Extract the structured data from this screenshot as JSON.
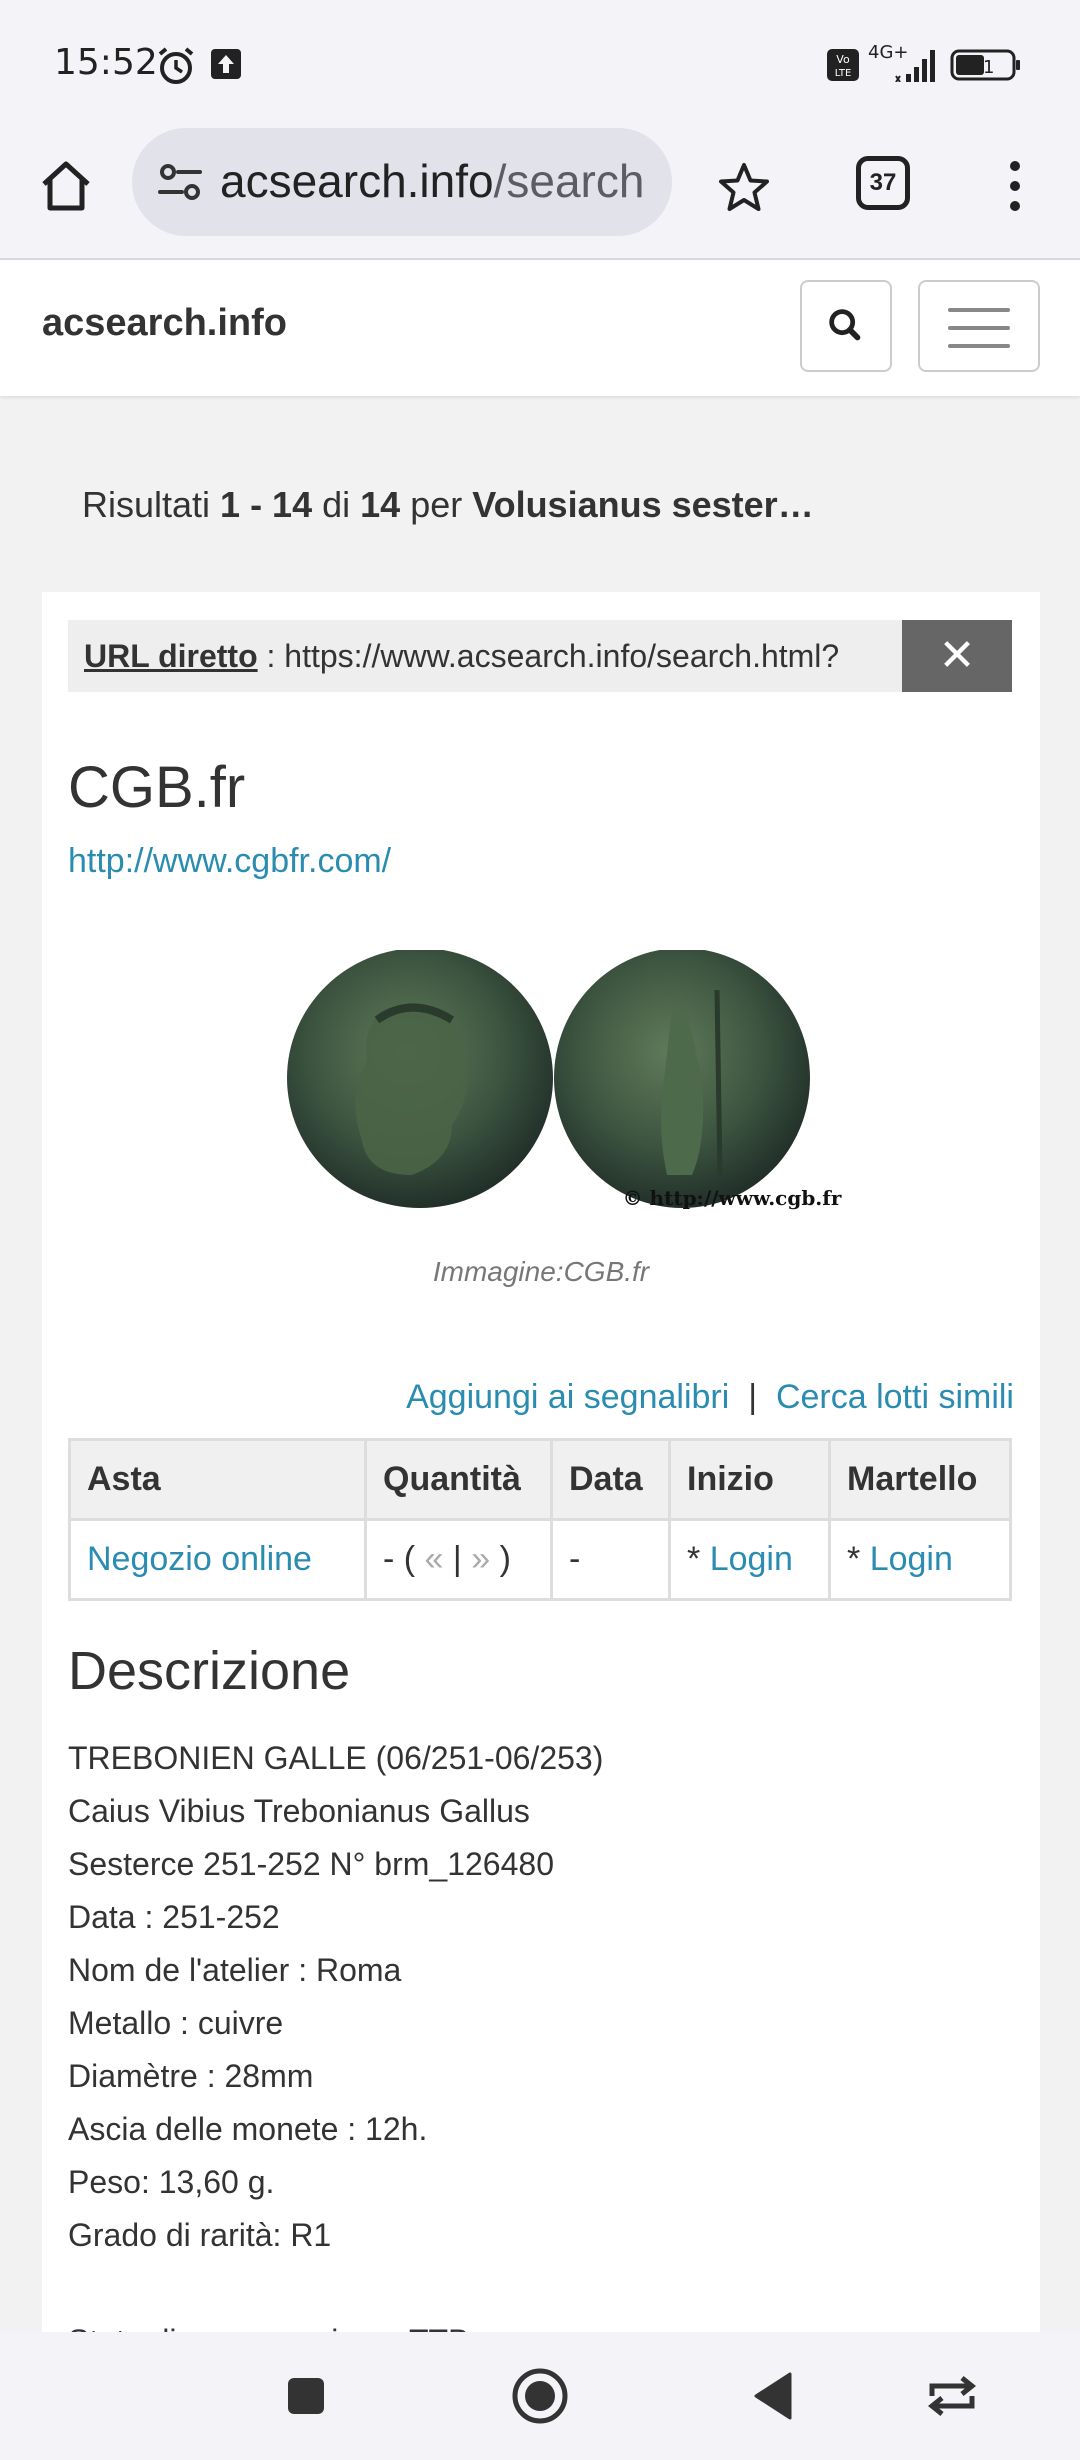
{
  "status_bar": {
    "time": "15:52",
    "network": "4G+",
    "battery": "51",
    "icons": [
      "alarm-icon",
      "upload-icon",
      "volte-icon",
      "signal-icon",
      "battery-icon"
    ]
  },
  "browser": {
    "url_host": "acsearch.info",
    "url_path": "/search",
    "tab_count": "37",
    "icons": [
      "home-icon",
      "site-info-icon",
      "star-icon",
      "tabs-icon",
      "menu-dots-icon"
    ]
  },
  "site": {
    "brand": "acsearch.info"
  },
  "results": {
    "prefix": "Risultati ",
    "range": "1 - 14",
    "of": " di ",
    "total": "14",
    "per": " per ",
    "query": "Volusianus sester…"
  },
  "direct_url": {
    "label": "URL diretto",
    "separator": " : ",
    "value": "https://www.acsearch.info/search.html?",
    "close": "✕"
  },
  "seller": {
    "name": "CGB.fr",
    "link": "http://www.cgbfr.com/"
  },
  "image": {
    "watermark": "© http://www.cgb.fr",
    "caption": "Immagine:CGB.fr"
  },
  "actions": {
    "bookmark": "Aggiungi ai segnalibri",
    "separator": "|",
    "similar": "Cerca lotti simili"
  },
  "table": {
    "headers": [
      "Asta",
      "Quantità",
      "Data",
      "Inizio",
      "Martello"
    ],
    "row": {
      "asta": "Negozio online",
      "quantita_prefix": "- (",
      "quantita_prev": "«",
      "quantita_sep": "|",
      "quantita_next": "»",
      "quantita_suffix": ")",
      "data": "-",
      "inizio_prefix": "* ",
      "inizio_link": "Login",
      "martello_prefix": "* ",
      "martello_link": "Login"
    }
  },
  "description": {
    "title": "Descrizione",
    "lines": [
      "TREBONIEN GALLE (06/251-06/253)",
      "Caius Vibius Trebonianus Gallus",
      "Sesterce 251-252 N° brm_126480",
      "Data : 251-252",
      "Nom de l'atelier : Roma",
      "Metallo : cuivre",
      "Diamètre : 28mm",
      "Ascia delle monete : 12h.",
      "Peso: 13,60 g.",
      "Grado di rarità: R1",
      "",
      "Stato di conservazione: TTB"
    ]
  },
  "nav": {
    "icons": [
      "recents-square-icon",
      "home-circle-icon",
      "back-triangle-icon",
      "rotate-icon"
    ]
  },
  "colors": {
    "link": "#2a8cb0",
    "background": "#f2f2f2",
    "chrome": "#f3f3f8"
  }
}
